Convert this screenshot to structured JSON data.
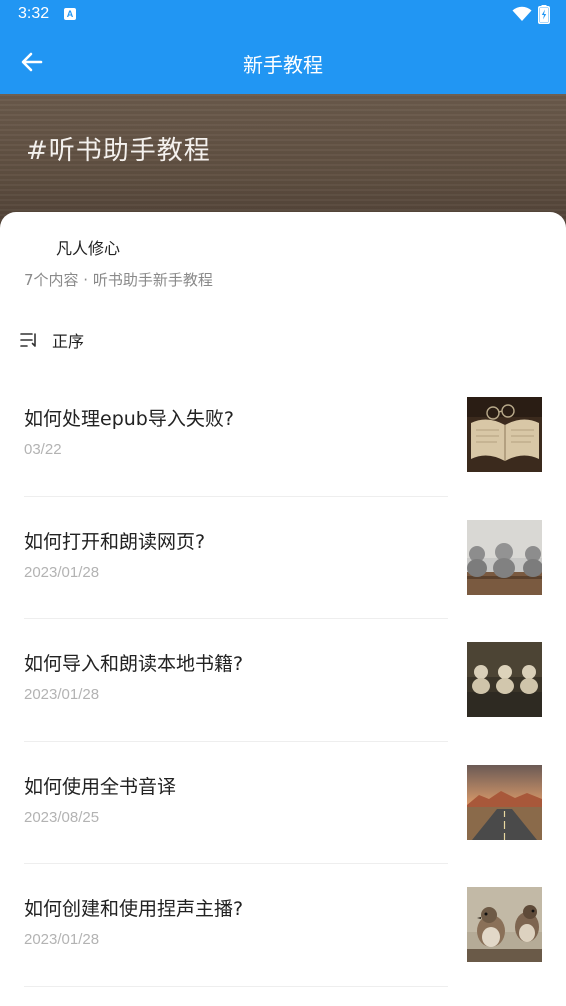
{
  "status_bar": {
    "time": "3:32",
    "a_icon_letter": "A",
    "icons": [
      "a-icon",
      "wifi-icon",
      "battery-charging-icon"
    ]
  },
  "app_bar": {
    "title": "新手教程",
    "back_icon": "arrow-left-icon"
  },
  "banner": {
    "title": "#听书助手教程"
  },
  "collection": {
    "author": "凡人修心",
    "meta": "7个内容 · 听书助手新手教程",
    "sort_label": "正序",
    "sort_icon": "sort-icon"
  },
  "items": [
    {
      "title": "如何处理epub导入失败?",
      "date": "03/22",
      "thumb": "open-book-glasses-image"
    },
    {
      "title": "如何打开和朗读网页?",
      "date": "2023/01/28",
      "thumb": "monk-statues-image"
    },
    {
      "title": "如何导入和朗读本地书籍?",
      "date": "2023/01/28",
      "thumb": "monk-figurines-image"
    },
    {
      "title": "如何使用全书音译",
      "date": "2023/08/25",
      "thumb": "desert-road-image"
    },
    {
      "title": "如何创建和使用捏声主播?",
      "date": "2023/01/28",
      "thumb": "sparrows-image"
    }
  ],
  "colors": {
    "primary": "#2196f3",
    "banner": "#5e4e40",
    "text": "#222222",
    "muted": "#8a8a8a",
    "date": "#b3b3b3"
  }
}
